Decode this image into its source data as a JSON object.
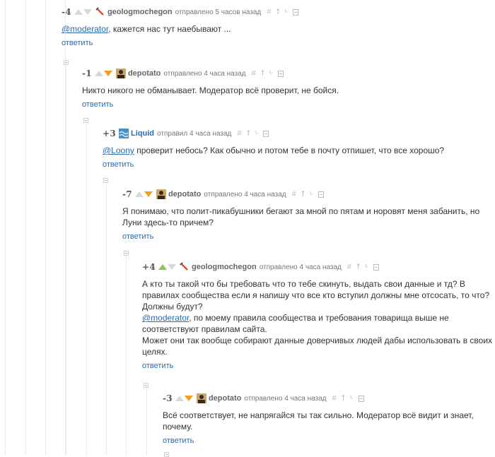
{
  "comments": [
    {
      "rating": "-4",
      "vote": "none",
      "username": "geologmochegon",
      "avatar": "pickaxe-avatar",
      "posted": "отправлено 5 часов назад",
      "mention": "@moderator",
      "text": ", кажется нас тут наебывают ...",
      "reply": "ответить"
    },
    {
      "rating": "-1",
      "vote": "down",
      "username": "depotato",
      "avatar": "person-avatar",
      "posted": "отправлено 4 часа назад",
      "text": "Никто никого не обманывает. Модератор всё проверит, не бойся.",
      "reply": "ответить"
    },
    {
      "rating": "+3",
      "vote": "none",
      "username": "Liquid",
      "avatar": "waves-avatar",
      "posted": "отправил 4 часа назад",
      "mention": "@Loony",
      "text": " проверит небось? Как обычно и потом тебе в почту отпишет, что все хорошо?",
      "reply": "ответить"
    },
    {
      "rating": "-7",
      "vote": "down",
      "username": "depotato",
      "avatar": "person-avatar",
      "posted": "отправлено 4 часа назад",
      "text": "Я понимаю, что полит-пикабушники бегают за мной по пятам и норовят меня забанить, но Луни здесь-то причем?",
      "reply": "ответить"
    },
    {
      "rating": "+4",
      "vote": "up",
      "username": "geologmochegon",
      "avatar": "pickaxe-avatar",
      "posted": "отправлено 4 часа назад",
      "text_before": "А кто ты такой что бы требовать что то тебе скинуть, выдать свои данные и тд? В правилах сообщества если я напишу что все кто вступил должны мне отсосать, то что? Должны будут?",
      "mention": "@moderator",
      "text": ", по моему правила сообщества и требования товарища выше не соответствуют правилам сайта.",
      "text_after": "Может они так вообще собирают данные доверчивых людей дабы использовать в своих целях.",
      "reply": "ответить"
    },
    {
      "rating": "-3",
      "vote": "down",
      "username": "depotato",
      "avatar": "person-avatar",
      "posted": "отправлено 4 часа назад",
      "text": "Всё соответствует, не напрягайся ты так сильно. Модератор всё видит и знает, почему.",
      "reply": "ответить"
    }
  ],
  "toolbar_icons": [
    "hash-icon",
    "arrow-up-icon",
    "branch-icon",
    "save-icon"
  ],
  "toolbar_hash": "#",
  "toolbar_up": "⭡",
  "toolbar_branch": "ᒡ",
  "colors": {
    "link": "#2a6ab3",
    "vote_up": "#8ac858",
    "vote_down": "#f0a020",
    "vote_inactive": "#d8d8d8"
  }
}
